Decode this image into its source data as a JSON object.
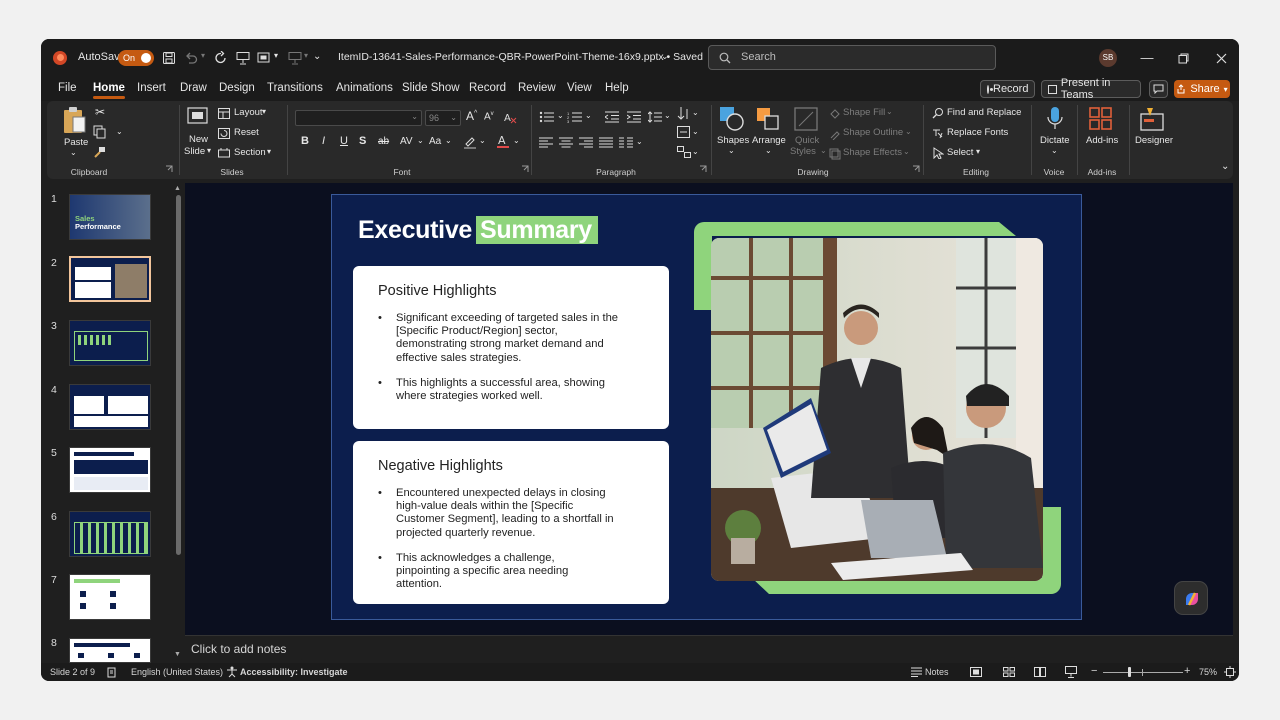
{
  "title_bar": {
    "autosave_label": "AutoSave",
    "autosave_state": "On",
    "file_title": "ItemID-13641-Sales-Performance-QBR-PowerPoint-Theme-16x9.pptx • Saved",
    "search_placeholder": "Search",
    "user_initials": "SB"
  },
  "tabs": [
    "File",
    "Home",
    "Insert",
    "Draw",
    "Design",
    "Transitions",
    "Animations",
    "Slide Show",
    "Record",
    "Review",
    "View",
    "Help"
  ],
  "right_buttons": {
    "record": "Record",
    "present": "Present in Teams",
    "share": "Share"
  },
  "ribbon": {
    "clipboard": {
      "paste": "Paste",
      "group": "Clipboard"
    },
    "slides": {
      "new_slide_1": "New",
      "new_slide_2": "Slide",
      "layout": "Layout",
      "reset": "Reset",
      "section": "Section",
      "group": "Slides"
    },
    "font": {
      "size": "96",
      "group": "Font"
    },
    "paragraph": {
      "group": "Paragraph"
    },
    "drawing": {
      "shapes": "Shapes",
      "arrange": "Arrange",
      "quick_styles_1": "Quick",
      "quick_styles_2": "Styles",
      "shape_fill": "Shape Fill",
      "shape_outline": "Shape Outline",
      "shape_effects": "Shape Effects",
      "group": "Drawing"
    },
    "editing": {
      "find_replace": "Find and Replace",
      "replace_fonts": "Replace Fonts",
      "select": "Select",
      "group": "Editing"
    },
    "voice": {
      "dictate": "Dictate",
      "group": "Voice"
    },
    "addins": {
      "addins": "Add-ins",
      "group": "Add-ins"
    },
    "designer": {
      "designer": "Designer"
    }
  },
  "slide_numbers": [
    "1",
    "2",
    "3",
    "4",
    "5",
    "6",
    "7",
    "8"
  ],
  "thumb1_text": {
    "title_1": "Sales",
    "title_2": "Performance"
  },
  "slide": {
    "title_main": "Executive",
    "title_highlight": "Summary",
    "positive": {
      "heading": "Positive Highlights",
      "bullets": [
        "Significant exceeding of targeted sales in the [Specific Product/Region] sector, demonstrating strong market demand and effective sales strategies.",
        "This highlights a successful area, showing where strategies worked well."
      ]
    },
    "negative": {
      "heading": "Negative Highlights",
      "bullets": [
        "Encountered unexpected delays in closing high-value deals within the [Specific Customer Segment], leading to a shortfall in projected quarterly revenue.",
        "This acknowledges a challenge, pinpointing a specific area needing attention."
      ]
    }
  },
  "notes_placeholder": "Click to add notes",
  "status_bar": {
    "slide_count": "Slide 2 of 9",
    "language": "English (United States)",
    "accessibility": "Accessibility: Investigate",
    "notes": "Notes",
    "zoom": "75%"
  },
  "colors": {
    "accent": "#c55a11",
    "slide_bg": "#0c1e4d",
    "highlight_green": "#8fd47c"
  }
}
